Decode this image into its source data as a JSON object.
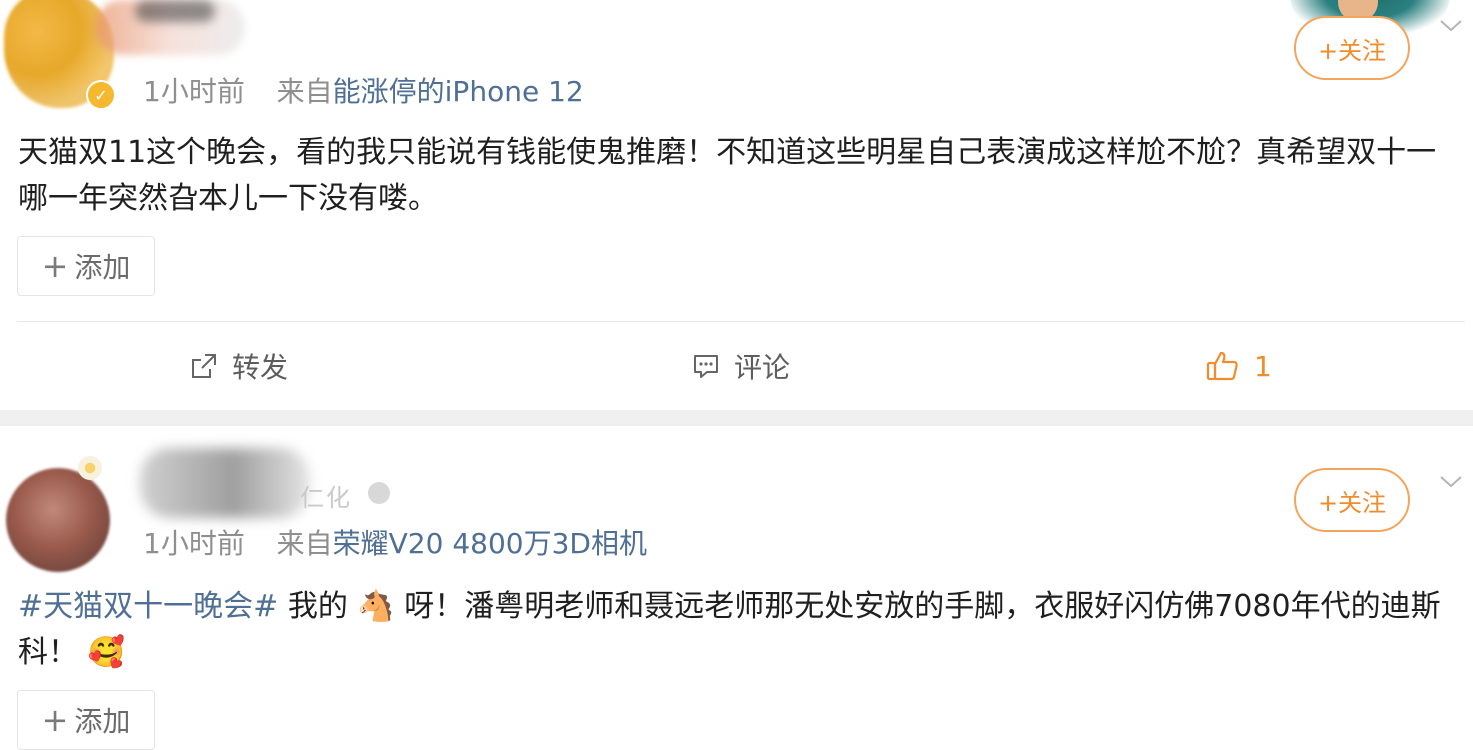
{
  "posts": [
    {
      "time": "1小时前",
      "from_prefix": "来自",
      "source": "能涨停的iPhone 12",
      "follow_label": "+关注",
      "content": "天猫双11这个晚会，看的我只能说有钱能使鬼推磨！不知道这些明星自己表演成这样尬不尬？真希望双十一哪一年突然旮本儿一下没有喽。",
      "add_label": "添加",
      "actions": {
        "repost_label": "转发",
        "comment_label": "评论",
        "like_count": "1"
      }
    },
    {
      "name_fragment": "仁化",
      "time": "1小时前",
      "from_prefix": "来自",
      "source": "荣耀V20 4800万3D相机",
      "follow_label": "+关注",
      "hashtag": "#天猫双十一晚会#",
      "content_a": " 我的 ",
      "emoji_horse": "🐴",
      "content_b": " 呀！潘粤明老师和聂远老师那无处安放的手脚，衣服好闪仿佛7080年代的迪斯科！",
      "emoji_face": "🥰",
      "add_label": "添加"
    }
  ],
  "colors": {
    "accent_orange": "#f08c2c",
    "link_blue": "#4f6f95",
    "meta_gray": "#8f8f8f"
  }
}
